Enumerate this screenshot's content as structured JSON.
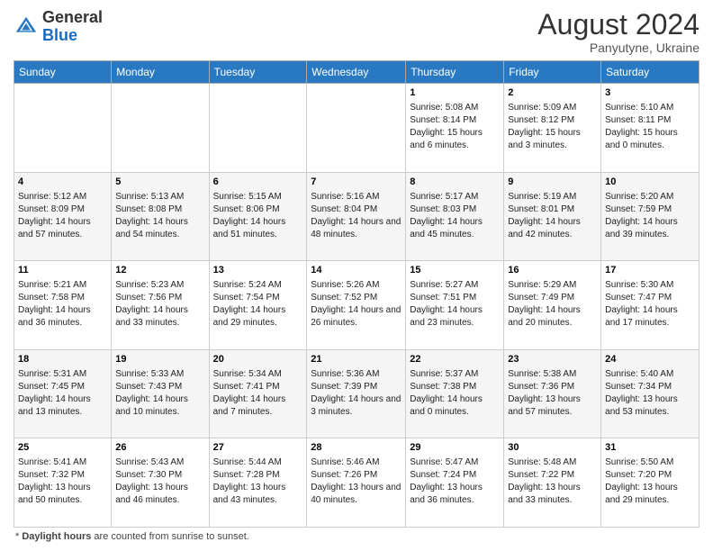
{
  "header": {
    "logo_general": "General",
    "logo_blue": "Blue",
    "month_year": "August 2024",
    "location": "Panyutyne, Ukraine"
  },
  "days_of_week": [
    "Sunday",
    "Monday",
    "Tuesday",
    "Wednesday",
    "Thursday",
    "Friday",
    "Saturday"
  ],
  "footer": {
    "label": "Daylight hours",
    "description": "Daylight hours"
  },
  "weeks": [
    [
      {
        "day": "",
        "sunrise": "",
        "sunset": "",
        "daylight": ""
      },
      {
        "day": "",
        "sunrise": "",
        "sunset": "",
        "daylight": ""
      },
      {
        "day": "",
        "sunrise": "",
        "sunset": "",
        "daylight": ""
      },
      {
        "day": "",
        "sunrise": "",
        "sunset": "",
        "daylight": ""
      },
      {
        "day": "1",
        "sunrise": "Sunrise: 5:08 AM",
        "sunset": "Sunset: 8:14 PM",
        "daylight": "Daylight: 15 hours and 6 minutes."
      },
      {
        "day": "2",
        "sunrise": "Sunrise: 5:09 AM",
        "sunset": "Sunset: 8:12 PM",
        "daylight": "Daylight: 15 hours and 3 minutes."
      },
      {
        "day": "3",
        "sunrise": "Sunrise: 5:10 AM",
        "sunset": "Sunset: 8:11 PM",
        "daylight": "Daylight: 15 hours and 0 minutes."
      }
    ],
    [
      {
        "day": "4",
        "sunrise": "Sunrise: 5:12 AM",
        "sunset": "Sunset: 8:09 PM",
        "daylight": "Daylight: 14 hours and 57 minutes."
      },
      {
        "day": "5",
        "sunrise": "Sunrise: 5:13 AM",
        "sunset": "Sunset: 8:08 PM",
        "daylight": "Daylight: 14 hours and 54 minutes."
      },
      {
        "day": "6",
        "sunrise": "Sunrise: 5:15 AM",
        "sunset": "Sunset: 8:06 PM",
        "daylight": "Daylight: 14 hours and 51 minutes."
      },
      {
        "day": "7",
        "sunrise": "Sunrise: 5:16 AM",
        "sunset": "Sunset: 8:04 PM",
        "daylight": "Daylight: 14 hours and 48 minutes."
      },
      {
        "day": "8",
        "sunrise": "Sunrise: 5:17 AM",
        "sunset": "Sunset: 8:03 PM",
        "daylight": "Daylight: 14 hours and 45 minutes."
      },
      {
        "day": "9",
        "sunrise": "Sunrise: 5:19 AM",
        "sunset": "Sunset: 8:01 PM",
        "daylight": "Daylight: 14 hours and 42 minutes."
      },
      {
        "day": "10",
        "sunrise": "Sunrise: 5:20 AM",
        "sunset": "Sunset: 7:59 PM",
        "daylight": "Daylight: 14 hours and 39 minutes."
      }
    ],
    [
      {
        "day": "11",
        "sunrise": "Sunrise: 5:21 AM",
        "sunset": "Sunset: 7:58 PM",
        "daylight": "Daylight: 14 hours and 36 minutes."
      },
      {
        "day": "12",
        "sunrise": "Sunrise: 5:23 AM",
        "sunset": "Sunset: 7:56 PM",
        "daylight": "Daylight: 14 hours and 33 minutes."
      },
      {
        "day": "13",
        "sunrise": "Sunrise: 5:24 AM",
        "sunset": "Sunset: 7:54 PM",
        "daylight": "Daylight: 14 hours and 29 minutes."
      },
      {
        "day": "14",
        "sunrise": "Sunrise: 5:26 AM",
        "sunset": "Sunset: 7:52 PM",
        "daylight": "Daylight: 14 hours and 26 minutes."
      },
      {
        "day": "15",
        "sunrise": "Sunrise: 5:27 AM",
        "sunset": "Sunset: 7:51 PM",
        "daylight": "Daylight: 14 hours and 23 minutes."
      },
      {
        "day": "16",
        "sunrise": "Sunrise: 5:29 AM",
        "sunset": "Sunset: 7:49 PM",
        "daylight": "Daylight: 14 hours and 20 minutes."
      },
      {
        "day": "17",
        "sunrise": "Sunrise: 5:30 AM",
        "sunset": "Sunset: 7:47 PM",
        "daylight": "Daylight: 14 hours and 17 minutes."
      }
    ],
    [
      {
        "day": "18",
        "sunrise": "Sunrise: 5:31 AM",
        "sunset": "Sunset: 7:45 PM",
        "daylight": "Daylight: 14 hours and 13 minutes."
      },
      {
        "day": "19",
        "sunrise": "Sunrise: 5:33 AM",
        "sunset": "Sunset: 7:43 PM",
        "daylight": "Daylight: 14 hours and 10 minutes."
      },
      {
        "day": "20",
        "sunrise": "Sunrise: 5:34 AM",
        "sunset": "Sunset: 7:41 PM",
        "daylight": "Daylight: 14 hours and 7 minutes."
      },
      {
        "day": "21",
        "sunrise": "Sunrise: 5:36 AM",
        "sunset": "Sunset: 7:39 PM",
        "daylight": "Daylight: 14 hours and 3 minutes."
      },
      {
        "day": "22",
        "sunrise": "Sunrise: 5:37 AM",
        "sunset": "Sunset: 7:38 PM",
        "daylight": "Daylight: 14 hours and 0 minutes."
      },
      {
        "day": "23",
        "sunrise": "Sunrise: 5:38 AM",
        "sunset": "Sunset: 7:36 PM",
        "daylight": "Daylight: 13 hours and 57 minutes."
      },
      {
        "day": "24",
        "sunrise": "Sunrise: 5:40 AM",
        "sunset": "Sunset: 7:34 PM",
        "daylight": "Daylight: 13 hours and 53 minutes."
      }
    ],
    [
      {
        "day": "25",
        "sunrise": "Sunrise: 5:41 AM",
        "sunset": "Sunset: 7:32 PM",
        "daylight": "Daylight: 13 hours and 50 minutes."
      },
      {
        "day": "26",
        "sunrise": "Sunrise: 5:43 AM",
        "sunset": "Sunset: 7:30 PM",
        "daylight": "Daylight: 13 hours and 46 minutes."
      },
      {
        "day": "27",
        "sunrise": "Sunrise: 5:44 AM",
        "sunset": "Sunset: 7:28 PM",
        "daylight": "Daylight: 13 hours and 43 minutes."
      },
      {
        "day": "28",
        "sunrise": "Sunrise: 5:46 AM",
        "sunset": "Sunset: 7:26 PM",
        "daylight": "Daylight: 13 hours and 40 minutes."
      },
      {
        "day": "29",
        "sunrise": "Sunrise: 5:47 AM",
        "sunset": "Sunset: 7:24 PM",
        "daylight": "Daylight: 13 hours and 36 minutes."
      },
      {
        "day": "30",
        "sunrise": "Sunrise: 5:48 AM",
        "sunset": "Sunset: 7:22 PM",
        "daylight": "Daylight: 13 hours and 33 minutes."
      },
      {
        "day": "31",
        "sunrise": "Sunrise: 5:50 AM",
        "sunset": "Sunset: 7:20 PM",
        "daylight": "Daylight: 13 hours and 29 minutes."
      }
    ]
  ]
}
